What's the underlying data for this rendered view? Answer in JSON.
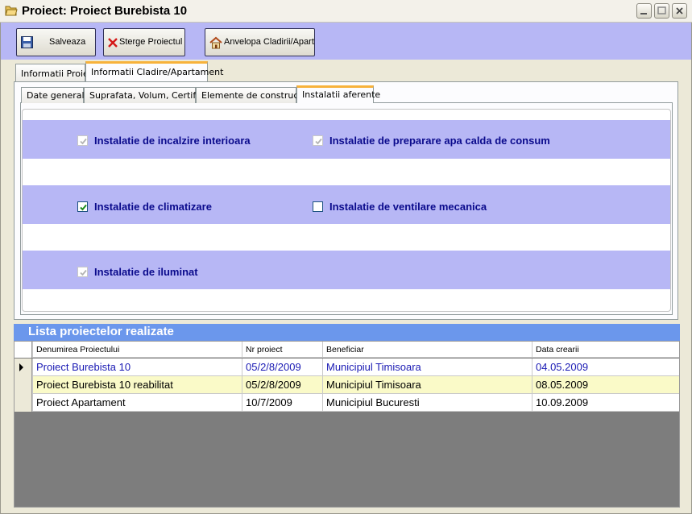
{
  "window": {
    "title": "Proiect: Proiect Burebista 10"
  },
  "toolbar": {
    "save_label": "Salveaza",
    "delete_label": "Sterge Proiectul",
    "envelope_label": "Anvelopa Cladirii/Apart"
  },
  "outer_tabs": [
    {
      "label": "Informatii Proiect"
    },
    {
      "label": "Informatii Cladire/Apartament",
      "active": true
    }
  ],
  "inner_tabs": [
    {
      "label": "Date generale"
    },
    {
      "label": "Suprafata, Volum, Certificat"
    },
    {
      "label": "Elemente de constructie"
    },
    {
      "label": "Instalatii aferente",
      "active": true
    }
  ],
  "installations": [
    {
      "label": "Instalatie de incalzire interioara",
      "checked": true,
      "enabled": false
    },
    {
      "label": "Instalatie de preparare apa calda de consum",
      "checked": true,
      "enabled": false
    },
    {
      "label": "Instalatie de climatizare",
      "checked": true,
      "enabled": true
    },
    {
      "label": "Instalatie de ventilare mecanica",
      "checked": false,
      "enabled": true
    },
    {
      "label": "Instalatie de iluminat",
      "checked": true,
      "enabled": false
    }
  ],
  "project_list": {
    "title": "Lista proiectelor realizate",
    "columns": [
      "Denumirea Proiectului",
      "Nr proiect",
      "Beneficiar",
      "Data crearii"
    ],
    "rows": [
      {
        "name": "Proiect Burebista 10",
        "nr": "05/2/8/2009",
        "beneficiary": "Municipiul Timisoara",
        "date": "04.05.2009",
        "selected": true
      },
      {
        "name": "Proiect Burebista 10 reabilitat",
        "nr": "05/2/8/2009",
        "beneficiary": "Municipiul Timisoara",
        "date": "08.05.2009"
      },
      {
        "name": "Proiect Apartament",
        "nr": "10/7/2009",
        "beneficiary": "Municipiul Bucuresti",
        "date": "10.09.2009"
      }
    ]
  },
  "colors": {
    "toolbar_bg": "#b7b7f5",
    "list_header_bg": "#6b97ec",
    "active_tab_accent": "#f7b23b",
    "checkbox_text": "#0a0a8c",
    "selected_row_text": "#1a1ab4",
    "alt_row_bg": "#fafac8",
    "grid_empty_bg": "#7d7d7d"
  },
  "icons": {
    "app": "folder-open-icon",
    "save": "floppy-disk-icon",
    "delete": "red-x-icon",
    "envelope": "house-icon",
    "row_indicator": "row-pointer-icon"
  }
}
